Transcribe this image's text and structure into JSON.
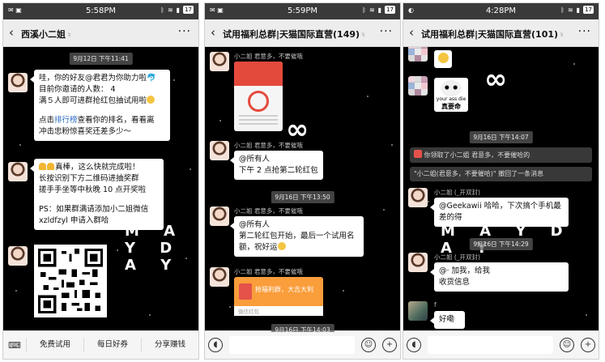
{
  "phones": [
    {
      "status": {
        "time": "5:58PM",
        "battery": "17"
      },
      "nav": {
        "title": "西溪小二姐",
        "more": "···"
      },
      "timestamp1": "9月12日 下午11:41",
      "msg1": {
        "line1": "哇，你的好友@君君为你助力啦",
        "line2": "目前你邀请的人数：  4",
        "line3": "满５人即可进群抢红包抽试用啦",
        "line4_pre": "点击",
        "line4_link": "排行榜",
        "line4_post": "查看你的排名，看看离",
        "line5": "冲击忠粉惊喜奖还差多少～"
      },
      "msg2": {
        "line1": "真棒，这么快就完成啦！",
        "line2": "长按识别下方二维码进抽奖群",
        "line3": "搓手手坐等中秋晚 10 点开奖啦",
        "line4": "PS：如果群满请添加小二姐微信",
        "line5": "xzldfzyl 申请入群哈"
      },
      "deco": "M A Y D A Y",
      "toolbar": {
        "items": [
          "免费试用",
          "每日好券",
          "分享赚钱"
        ]
      }
    },
    {
      "status": {
        "time": "5:59PM",
        "battery": "17"
      },
      "nav": {
        "title": "试用福利总群|天猫国际直营(149)",
        "more": "···"
      },
      "sender1": "小二姐 君意多，不要催哦",
      "timestamp1": "9月16日 下午13:50",
      "sender2": "小二姐 君意多，不要催哦",
      "msg2": {
        "line1": "@所有人",
        "line2": "下午 2 点抢第二轮红包"
      },
      "sender3": "小二姐 君意多，不要催哦",
      "msg3": {
        "line1": "@所有人",
        "line2": "第二轮红包开始，最后一个试用名",
        "line3": "额，祝好运"
      },
      "sender4": "小二姐 君意多，不要催哦",
      "redpacket": {
        "text": "抢福利群，大吉大利",
        "foot": "微信红包"
      },
      "timestamp2": "9月16日 下午14:03",
      "deco_top": "∞"
    },
    {
      "status": {
        "time": "4:28PM",
        "battery": "17"
      },
      "nav": {
        "title": "试用福利总群|天猫国际直营(101)",
        "more": "···"
      },
      "sticker": {
        "cap": "your ass die",
        "cap2": "真要命"
      },
      "timestamp1": "9月16日 下午14:07",
      "sys1": "你领取了小二姐 君意多，不要催哈的",
      "sys2": "\"小二姐(君意多，不要催哈)\" 撤回了一条消息",
      "sender1": "小二姐 (_开双封)",
      "msg1": {
        "line1": "@Geekawii  哈哈，下次搞个手机最",
        "line2": "差的得"
      },
      "timestamp2": "9月16日 下午14:29",
      "sender2": "小二姐 (_开双封)",
      "msg2": {
        "line1": "@·   加我，给我",
        "line2": "收货信息"
      },
      "sender3": "f",
      "msg3": {
        "line1": "好嘞"
      },
      "deco": "M A Y D A Y",
      "deco_top": "∞"
    }
  ]
}
